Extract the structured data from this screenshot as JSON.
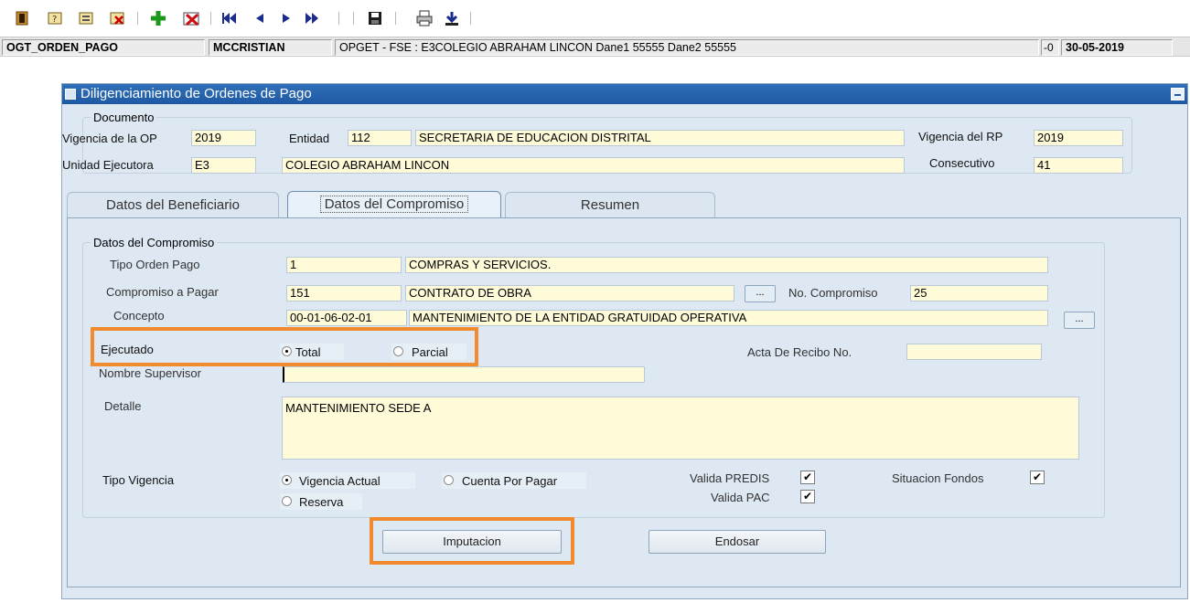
{
  "toolbar": {
    "icons": [
      "exit-icon",
      "query-icon",
      "enter-query-icon",
      "cancel-query-icon",
      "insert-record-icon",
      "delete-record-icon",
      "first-record-icon",
      "previous-record-icon",
      "next-record-icon",
      "last-record-icon",
      "save-icon",
      "print-icon",
      "download-icon"
    ]
  },
  "status": {
    "form": "OGT_ORDEN_PAGO",
    "user": "MCCRISTIAN",
    "context": "OPGET - FSE : E3COLEGIO ABRAHAM LINCON Dane1 55555 Dane2 55555",
    "code": "-0",
    "date": "30-05-2019"
  },
  "window": {
    "title": "Diligenciamiento de Ordenes de Pago"
  },
  "documento": {
    "legend": "Documento",
    "vigencia_op_label": "Vigencia de la OP",
    "vigencia_op": "2019",
    "entidad_label": "Entidad",
    "entidad_code": "112",
    "entidad_name": "SECRETARIA DE EDUCACION DISTRITAL",
    "vigencia_rp_label": "Vigencia del RP",
    "vigencia_rp": "2019",
    "unidad_label": "Unidad Ejecutora",
    "unidad_code": "E3",
    "unidad_name": "COLEGIO ABRAHAM LINCON",
    "consecutivo_label": "Consecutivo",
    "consecutivo": "41"
  },
  "tabs": [
    {
      "label": "Datos del Beneficiario"
    },
    {
      "label": "Datos del Compromiso"
    },
    {
      "label": "Resumen"
    }
  ],
  "compromiso": {
    "legend": "Datos del Compromiso",
    "tipo_label": "Tipo Orden Pago",
    "tipo_code": "1",
    "tipo_name": "COMPRAS Y SERVICIOS.",
    "comp_label": "Compromiso a Pagar",
    "comp_code": "151",
    "comp_name": "CONTRATO DE OBRA",
    "lov_label": "...",
    "no_comp_label": "No. Compromiso",
    "no_comp": "25",
    "concepto_label": "Concepto",
    "concepto_code": "00-01-06-02-01",
    "concepto_name": "MANTENIMIENTO DE LA ENTIDAD GRATUIDAD OPERATIVA",
    "ejecutado_label": "Ejecutado",
    "total_label": "Total",
    "parcial_label": "Parcial",
    "acta_label": "Acta De Recibo No.",
    "acta_value": "",
    "supervisor_label": "Nombre Supervisor",
    "supervisor_value": "",
    "detalle_label": "Detalle",
    "detalle_value": "MANTENIMIENTO SEDE A",
    "tipo_vig_label": "Tipo Vigencia",
    "vig_actual_label": "Vigencia Actual",
    "cuenta_label": "Cuenta Por Pagar",
    "reserva_label": "Reserva",
    "valida_predis_label": "Valida PREDIS",
    "valida_pac_label": "Valida PAC",
    "situacion_label": "Situacion Fondos",
    "check_mark": "✔",
    "imputacion_label": "Imputacion",
    "endosar_label": "Endosar"
  },
  "colors": {
    "highlight": "#f28a2e",
    "titlebar": "#1e5aa3",
    "field_bg": "#fffbd9",
    "window_bg": "#dde8f3"
  }
}
